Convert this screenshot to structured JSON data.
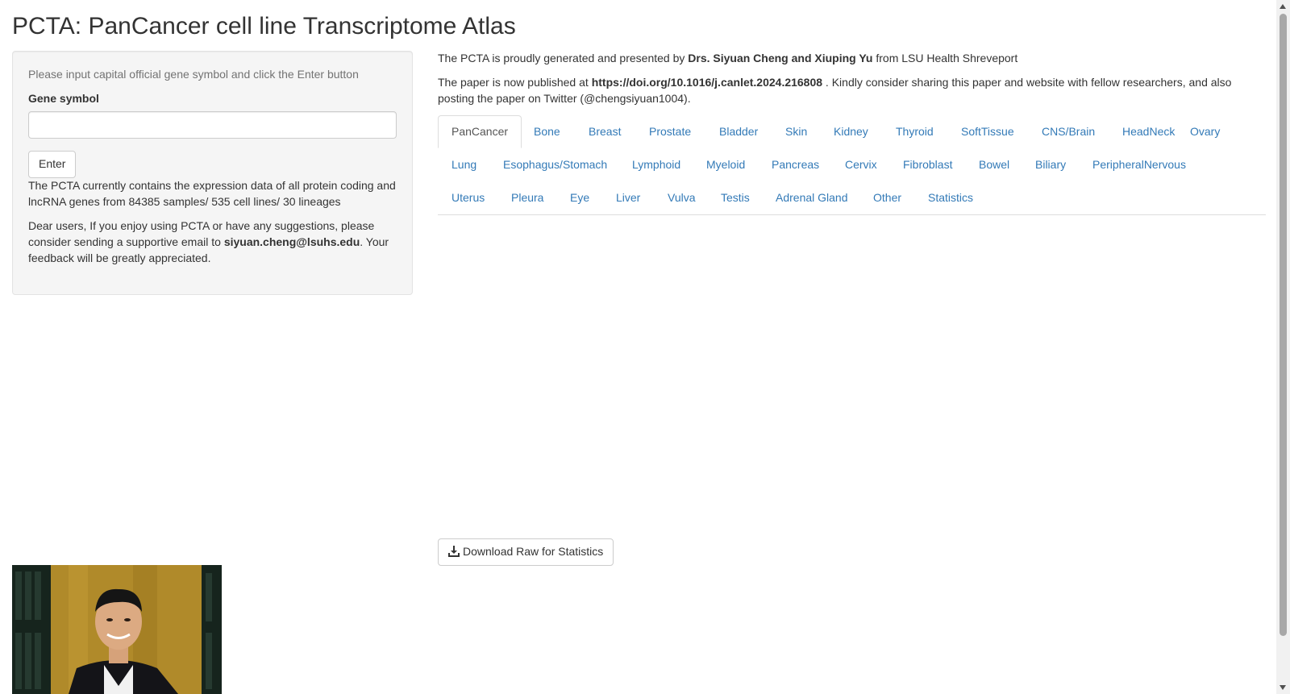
{
  "page": {
    "title": "PCTA: PanCancer cell line Transcriptome Atlas"
  },
  "sidebar": {
    "help_text": "Please input capital official gene symbol and click the Enter button",
    "gene_label": "Gene symbol",
    "gene_value": "",
    "gene_placeholder": "",
    "enter_label": "Enter",
    "info_text": "The PCTA currently contains the expression data of all protein coding and lncRNA genes from 84385 samples/ 535 cell lines/ 30 lineages",
    "feedback_pre": "Dear users, If you enjoy using PCTA or have any suggestions, please consider sending a supportive email to ",
    "feedback_email": "siyuan.cheng@lsuhs.edu",
    "feedback_post": ". Your feedback will be greatly appreciated."
  },
  "main": {
    "intro_pre": "The PCTA is proudly generated and presented by ",
    "intro_authors": "Drs. Siyuan Cheng and Xiuping Yu",
    "intro_post": " from LSU Health Shreveport",
    "paper_pre": "The paper is now published at ",
    "paper_doi": "https://doi.org/10.1016/j.canlet.2024.216808",
    "paper_post": " . Kindly consider sharing this paper and website with fellow researchers, and also posting the paper on Twitter (@chengsiyuan1004).",
    "active_tab": "PanCancer",
    "tabs": [
      "PanCancer",
      "Bone",
      "Breast",
      "Prostate",
      "Bladder",
      "Skin",
      "Kidney",
      "Thyroid",
      "SoftTissue",
      "CNS/Brain",
      "HeadNeck",
      "Ovary",
      "Lung",
      "Esophagus/Stomach",
      "Lymphoid",
      "Myeloid",
      "Pancreas",
      "Cervix",
      "Fibroblast",
      "Bowel",
      "Biliary",
      "PeripheralNervous",
      "Uterus",
      "Pleura",
      "Eye",
      "Liver",
      "Vulva",
      "Testis",
      "Adrenal Gland",
      "Other",
      "Statistics"
    ],
    "download_label": "Download Raw for Statistics"
  },
  "colors": {
    "link": "#337ab7",
    "panel_bg": "#f5f5f5",
    "text": "#333333"
  },
  "icons": {
    "download": "download-icon"
  }
}
